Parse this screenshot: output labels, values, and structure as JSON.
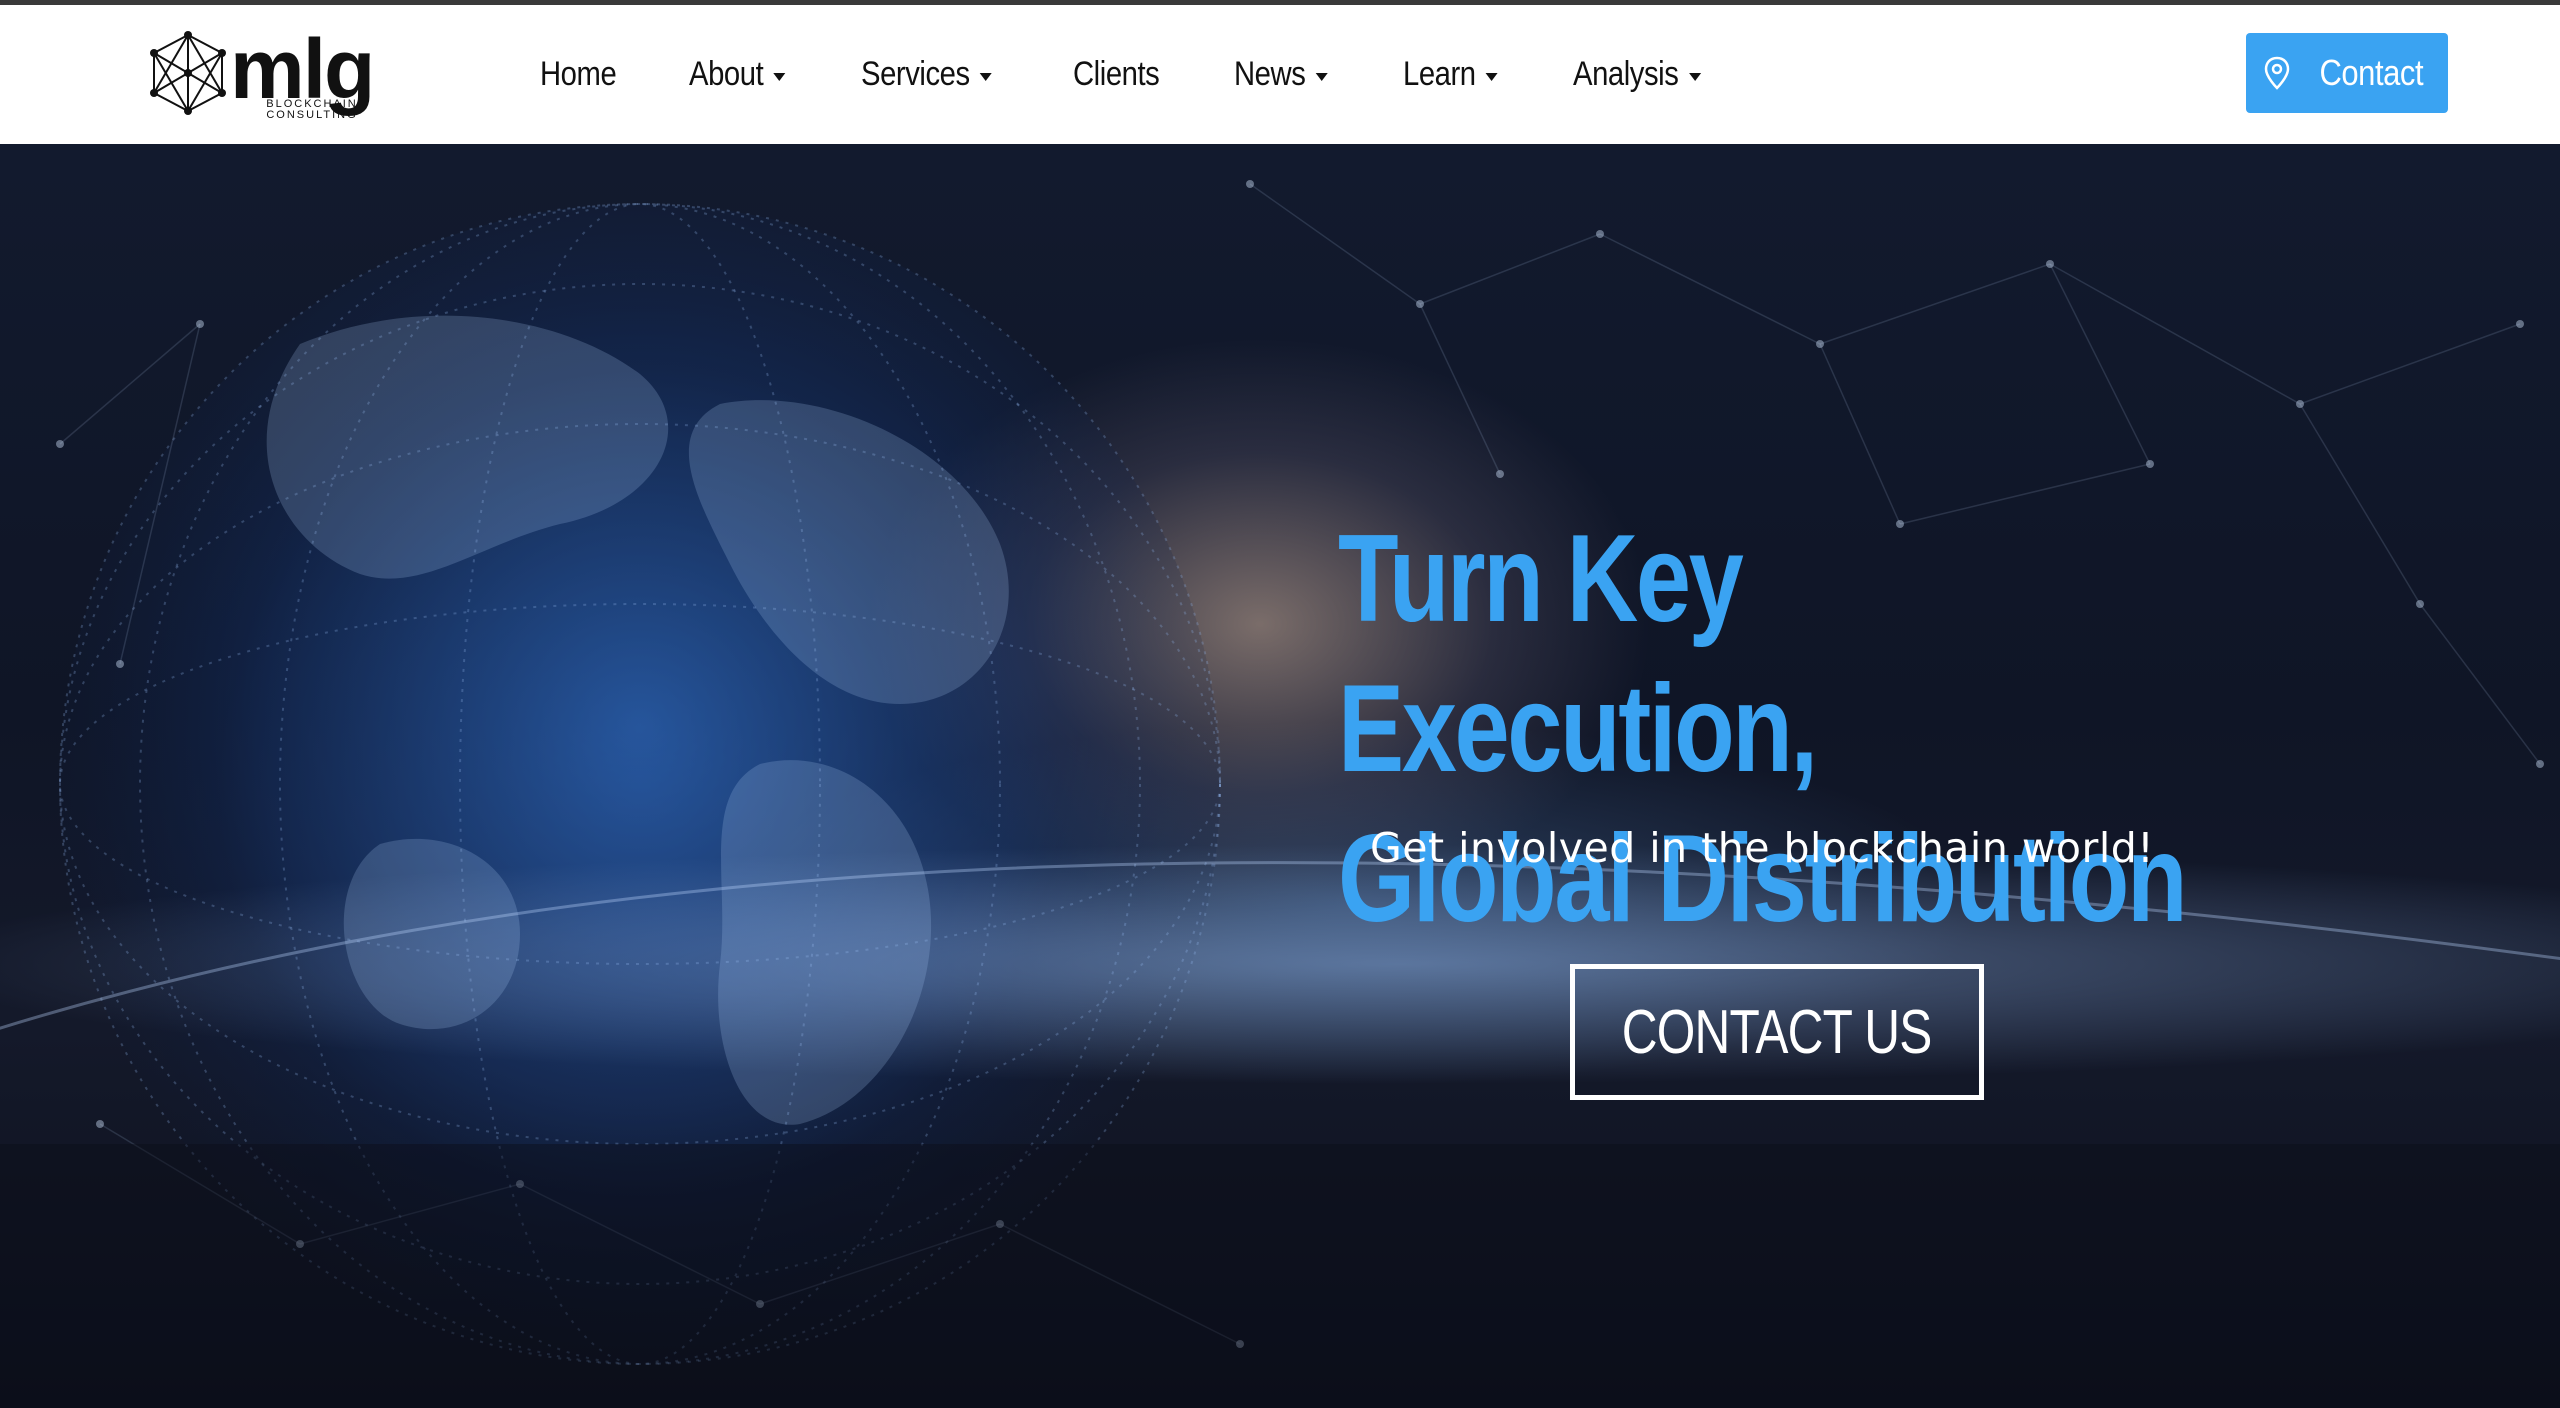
{
  "brand": {
    "name": "mlg",
    "tagline_line1": "BLOCKCHAIN",
    "tagline_line2": "CONSULTING"
  },
  "nav": {
    "items": [
      {
        "label": "Home",
        "dropdown": false
      },
      {
        "label": "About",
        "dropdown": true
      },
      {
        "label": "Services",
        "dropdown": true
      },
      {
        "label": "Clients",
        "dropdown": false
      },
      {
        "label": "News",
        "dropdown": true
      },
      {
        "label": "Learn",
        "dropdown": true
      },
      {
        "label": "Analysis",
        "dropdown": true
      }
    ]
  },
  "header": {
    "contact_label": "Contact",
    "contact_icon": "map-pin-icon"
  },
  "hero": {
    "title_line1": "Turn Key Execution,",
    "title_line2": "Global Distribution",
    "subtitle": "Get involved in the blockchain world!",
    "cta_label": "CONTACT US"
  },
  "colors": {
    "accent": "#3aa3f2",
    "header_bg": "#ffffff",
    "hero_bg": "#0f1526"
  }
}
